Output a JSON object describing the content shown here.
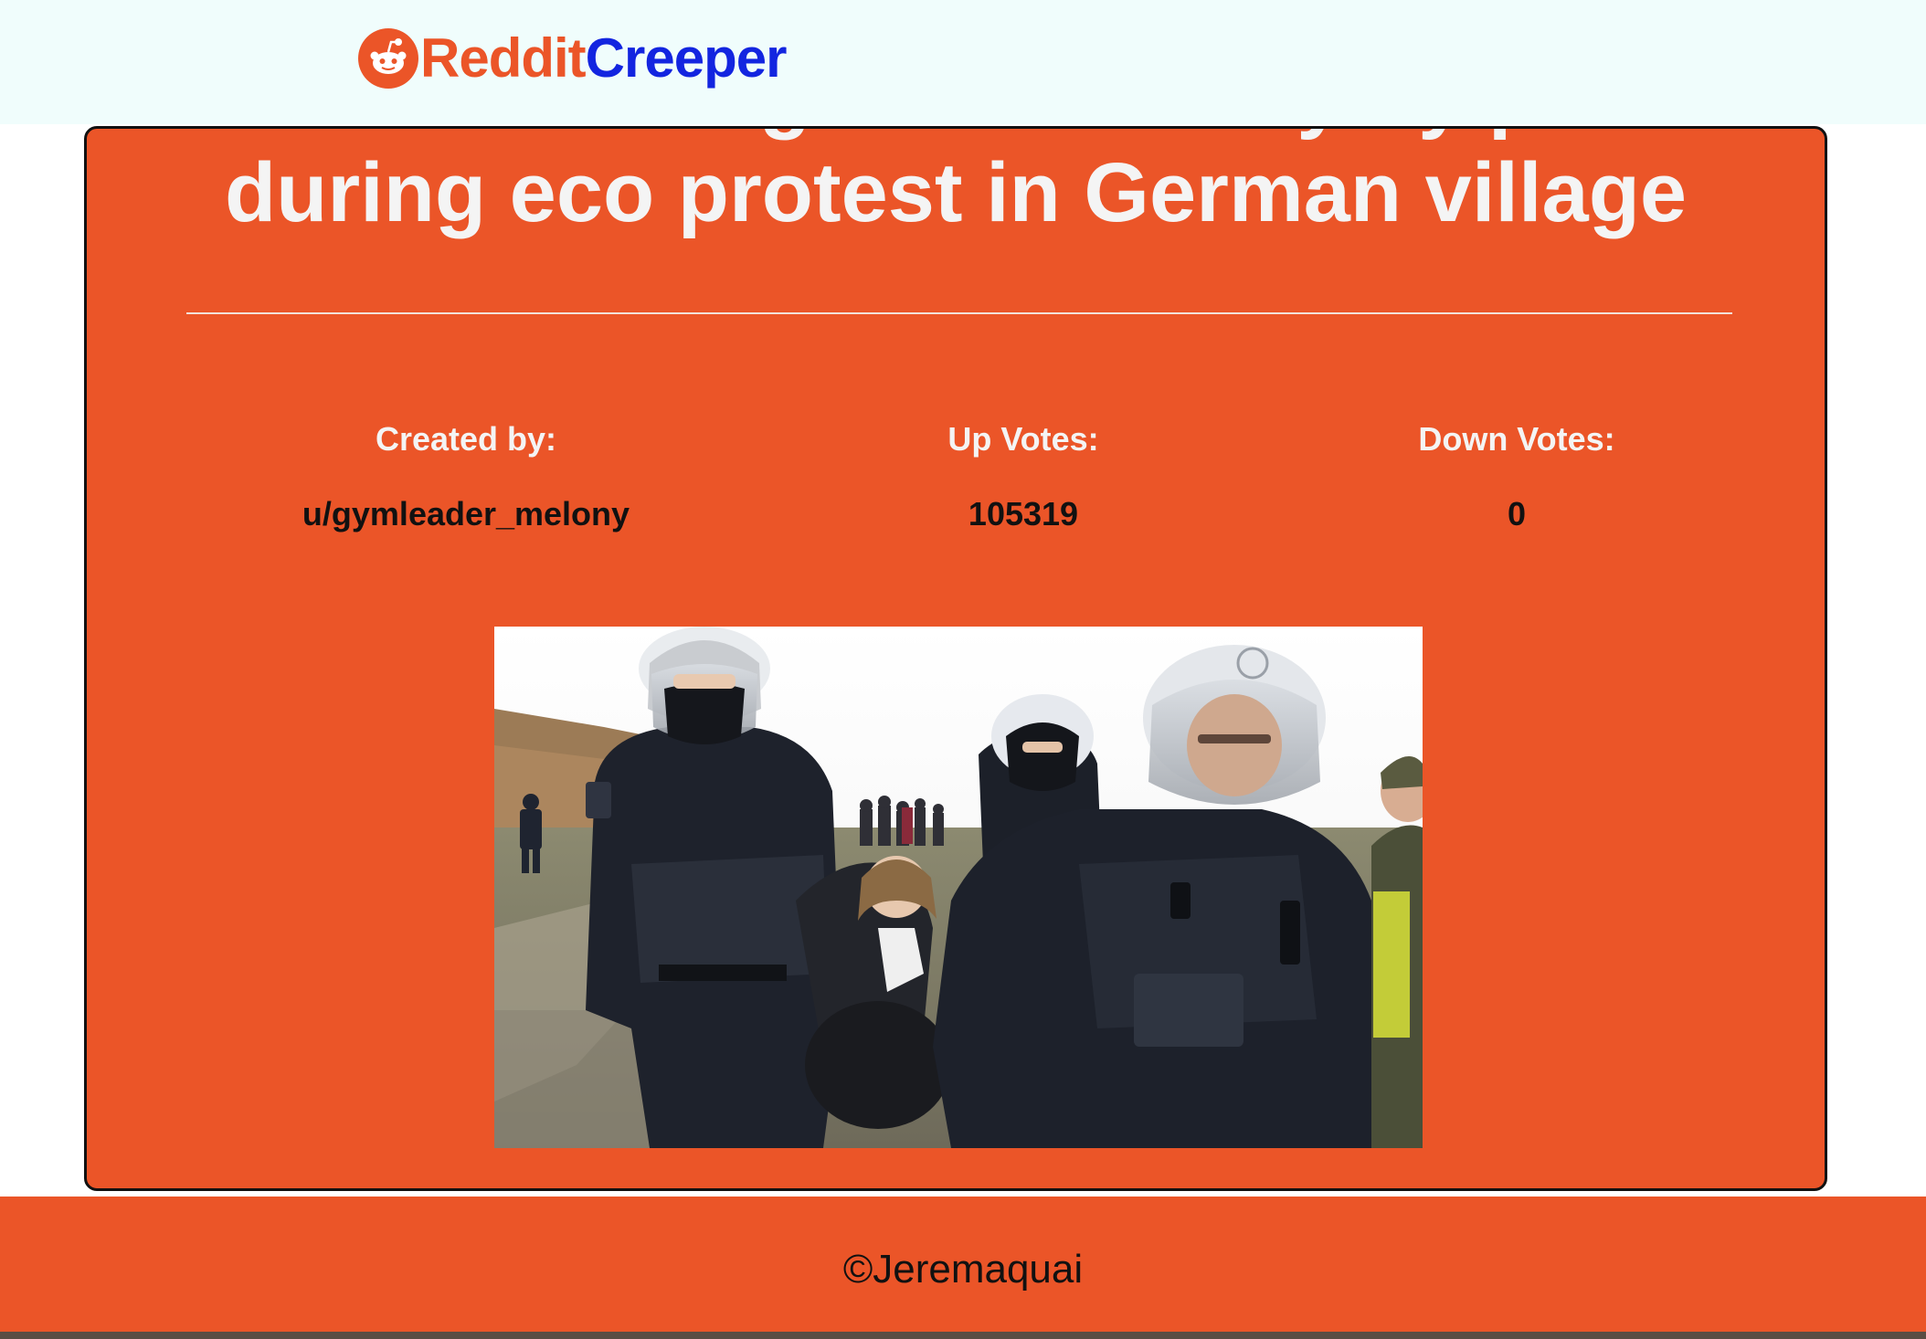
{
  "header": {
    "brand_part1": "Reddit",
    "brand_part2": "Creeper",
    "logo_icon": "reddit-alien-icon"
  },
  "post": {
    "title": "Greta Thunberg carried away by police during eco protest in German village",
    "stats": {
      "author_label": "Created by:",
      "author_value": "u/gymleader_melony",
      "upvotes_label": "Up Votes:",
      "upvotes_value": "105319",
      "downvotes_label": "Down Votes:",
      "downvotes_value": "0"
    },
    "image_alt": "Police officers in riot gear carrying a protester"
  },
  "footer": {
    "copyright": "©Jeremaquai"
  },
  "colors": {
    "accent_orange": "#eb5528",
    "brand_blue": "#1325e0",
    "header_bg": "#f0fdfc",
    "text_light": "#f4f4f4",
    "text_dark": "#111111"
  }
}
